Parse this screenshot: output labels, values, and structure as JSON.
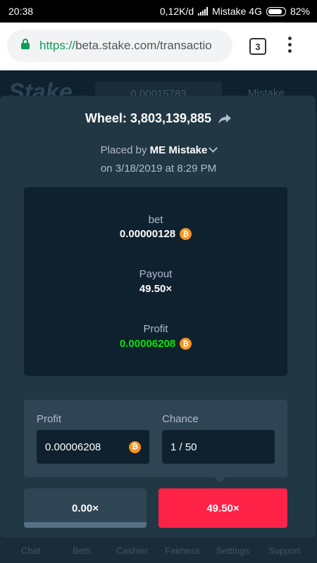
{
  "status_bar": {
    "time": "20:38",
    "speed": "0,12K/d",
    "carrier": "Mistake 4G",
    "battery": "82%"
  },
  "browser": {
    "url_scheme": "https://",
    "url_rest": "beta.stake.com/transactio",
    "tab_count": "3"
  },
  "background_header": {
    "logo": "Stake",
    "balance": "0.00015783",
    "username": "Mistake"
  },
  "modal": {
    "title": "Wheel: 3,803,139,885",
    "placed_by_prefix": "Placed by ",
    "user": "ME Mistake",
    "date": "on 3/18/2019 at 8:29 PM",
    "details": {
      "bet_label": "bet",
      "bet_value": "0.00000128",
      "payout_label": "Payout",
      "payout_value": "49.50×",
      "profit_label": "Profit",
      "profit_value": "0.00006208"
    },
    "stats": {
      "profit_label": "Profit",
      "profit_value": "0.00006208",
      "chance_label": "Chance",
      "chance_value": "1 / 50"
    },
    "multipliers": {
      "left": "0.00×",
      "right": "49.50×"
    }
  },
  "bottom_nav": [
    "Chat",
    "Bets",
    "Cashier",
    "Fairness",
    "Settings",
    "Support"
  ],
  "colors": {
    "accent_red": "#fe2247",
    "profit_green": "#00e701",
    "btc_orange": "#f7931a"
  },
  "icons": {
    "currency": "btc-icon",
    "share": "share-icon"
  }
}
